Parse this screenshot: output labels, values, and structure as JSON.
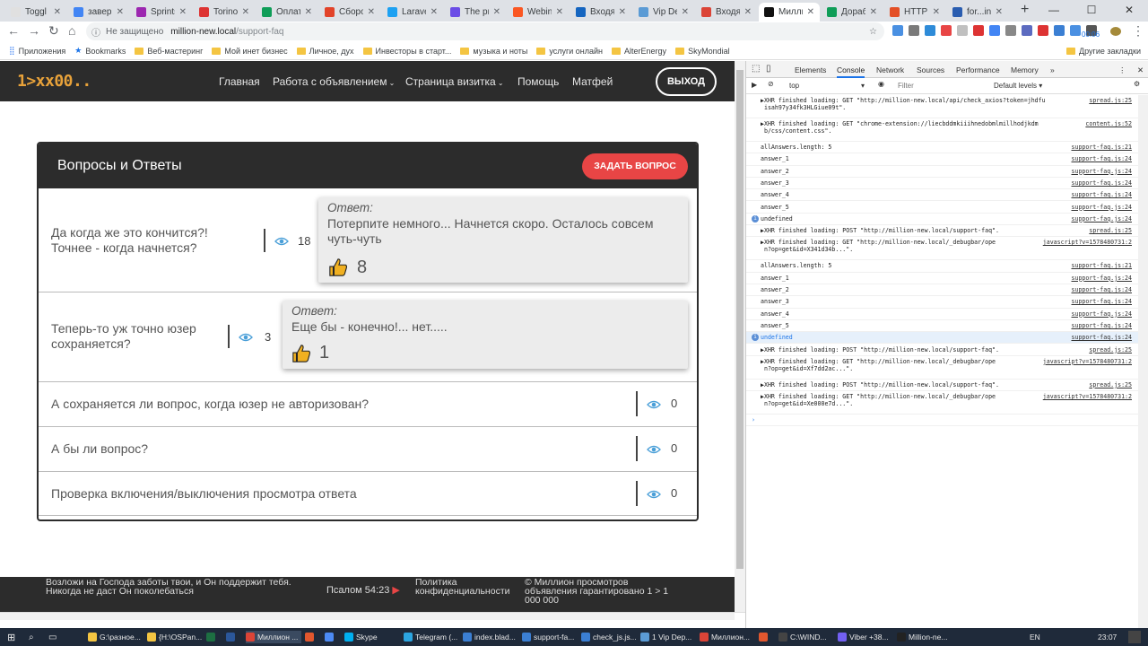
{
  "browser": {
    "tabs": [
      {
        "label": "Toggl",
        "color": "#e0e0e0"
      },
      {
        "label": "заверш",
        "color": "#4285f4"
      },
      {
        "label": "Sprints",
        "color": "#9c27b0"
      },
      {
        "label": "Torino",
        "color": "#d33"
      },
      {
        "label": "Оплата",
        "color": "#0f9d58"
      },
      {
        "label": "Сборо",
        "color": "#e24329"
      },
      {
        "label": "Laravel",
        "color": "#1da1f2"
      },
      {
        "label": "The pro",
        "color": "#6b4de6"
      },
      {
        "label": "Webiny",
        "color": "#fa5723"
      },
      {
        "label": "Входящ",
        "color": "#1565c0"
      },
      {
        "label": "Vip Dep",
        "color": "#5b9bd5"
      },
      {
        "label": "Входящ",
        "color": "#db4437"
      },
      {
        "label": "Миллио",
        "color": "#111"
      },
      {
        "label": "Доработ",
        "color": "#0f9d58"
      },
      {
        "label": "HTTP S",
        "color": "#e34f26"
      },
      {
        "label": "for...in",
        "color": "#2a5db0"
      }
    ],
    "active_tab": 12,
    "newtab_label": "+",
    "window_controls": [
      "—",
      "☐",
      "✕"
    ],
    "security_label": "Не защищено",
    "url_host": "million-new.local",
    "url_path": "/support-faq",
    "bookmarks": [
      "Приложения",
      "Bookmarks",
      "Веб-мастеринг",
      "Мой инет бизнес",
      "Личное, дух",
      "Инвесторы в старт...",
      "музыка и ноты",
      "услуги онлайн",
      "AlterEnergy",
      "SkyMondial"
    ],
    "other_bookmarks": "Другие закладки",
    "ext_badge": "00:06"
  },
  "site": {
    "logo": "1>xx00..",
    "nav": [
      {
        "label": "Главная"
      },
      {
        "label": "Работа с объявлением"
      },
      {
        "label": "Страница визитка"
      },
      {
        "label": "Помощь"
      },
      {
        "label": "Матфей"
      }
    ],
    "logout": "ВЫХОД",
    "faq_title": "Вопросы и Ответы",
    "ask_button": "ЗАДАТЬ ВОПРОС",
    "answer_label": "Ответ:",
    "questions": [
      {
        "text": "Да когда же это кончится?! Точнее - когда начнется?",
        "views": "18",
        "answer": "Потерпите немного... Начнется скоро. Осталось совсем чуть-чуть",
        "likes": "8"
      },
      {
        "text": "Теперь-то уж точно юзер сохраняется?",
        "views": "3",
        "answer": "Еще бы - конечно!... нет.....",
        "likes": "1"
      },
      {
        "text": "А сохраняется ли вопрос, когда юзер не авторизован?",
        "views": "0"
      },
      {
        "text": "А бы ли вопрос?",
        "views": "0"
      },
      {
        "text": "Проверка включения/выключения просмотра ответа",
        "views": "0"
      }
    ],
    "footer": {
      "quote": "Возложи на Господа заботы твои, и Он поддержит тебя. Никогда не даст Он поколебаться",
      "quote_ref": "Псалом 54:23",
      "privacy": "Политика конфиденциальности",
      "copyright": "© Миллион просмотров объявления гарантировано 1 > 1 000 000"
    }
  },
  "devtools": {
    "tabs": [
      "Elements",
      "Console",
      "Network",
      "Sources",
      "Performance",
      "Memory",
      "»"
    ],
    "active_tab": "Console",
    "context": "top",
    "filter_placeholder": "Filter",
    "levels": "Default levels ▾",
    "logs": [
      {
        "msg": "▶XHR finished loading: GET \"http://million-new.local/api/check_axios?token=jhdfu\n isah97y34fk3HLGiue09t\".",
        "src": "spread.js:25",
        "h": 2
      },
      {
        "msg": "▶XHR finished loading: GET \"chrome-extension://liecbddmkiiihnedobmlmillhodjkdm\n b/css/content.css\".",
        "src": "content.js:52",
        "h": 2
      },
      {
        "msg": "allAnswers.length: 5",
        "src": "support-faq.js:21",
        "h": 1
      },
      {
        "msg": "answer_1",
        "src": "support-faq.js:24",
        "h": 1
      },
      {
        "msg": "answer_2",
        "src": "support-faq.js:24",
        "h": 1
      },
      {
        "msg": "answer_3",
        "src": "support-faq.js:24",
        "h": 1
      },
      {
        "msg": "answer_4",
        "src": "support-faq.js:24",
        "h": 1
      },
      {
        "msg": "answer_5",
        "src": "support-faq.js:24",
        "h": 1
      },
      {
        "msg": "undefined",
        "src": "support-faq.js:24",
        "h": 1,
        "info": true
      },
      {
        "msg": "▶XHR finished loading: POST \"http://million-new.local/support-faq\".",
        "src": "spread.js:25",
        "h": 1
      },
      {
        "msg": "▶XHR finished loading: GET \"http://million-new.local/_debugbar/ope\n n?op=get&id=X341d34b...\".",
        "src": "javascript?v=1578480731:2",
        "h": 2
      },
      {
        "msg": "allAnswers.length: 5",
        "src": "support-faq.js:21",
        "h": 1
      },
      {
        "msg": "answer_1",
        "src": "support-faq.js:24",
        "h": 1
      },
      {
        "msg": "answer_2",
        "src": "support-faq.js:24",
        "h": 1
      },
      {
        "msg": "answer_3",
        "src": "support-faq.js:24",
        "h": 1
      },
      {
        "msg": "answer_4",
        "src": "support-faq.js:24",
        "h": 1
      },
      {
        "msg": "answer_5",
        "src": "support-faq.js:24",
        "h": 1
      },
      {
        "msg": "undefined",
        "src": "support-faq.js:24",
        "h": 1,
        "info": true,
        "sel": true
      },
      {
        "msg": "▶XHR finished loading: POST \"http://million-new.local/support-faq\".",
        "src": "spread.js:25",
        "h": 1
      },
      {
        "msg": "▶XHR finished loading: GET \"http://million-new.local/_debugbar/ope\n n?op=get&id=Xf7dd2ac...\".",
        "src": "javascript?v=1578480731:2",
        "h": 2
      },
      {
        "msg": "▶XHR finished loading: POST \"http://million-new.local/support-faq\".",
        "src": "spread.js:25",
        "h": 1
      },
      {
        "msg": "▶XHR finished loading: GET \"http://million-new.local/_debugbar/ope\n n?op=get&id=Xe000e7d...\".",
        "src": "javascript?v=1578480731:2",
        "h": 2
      },
      {
        "msg": "›",
        "src": "",
        "h": 1
      }
    ]
  },
  "taskbar": {
    "items": [
      {
        "label": "G:\\разное...",
        "color": "#f4c542"
      },
      {
        "label": "{H:\\OSPan...",
        "color": "#f4c542"
      },
      {
        "label": "",
        "color": "#1d6f42"
      },
      {
        "label": "",
        "color": "#2b579a"
      },
      {
        "label": "Миллион ...",
        "color": "#db4437",
        "active": true
      },
      {
        "label": "",
        "color": "#e2572e"
      },
      {
        "label": "",
        "color": "#4c8bf5"
      },
      {
        "label": "Skype",
        "color": "#00aff0"
      },
      {
        "label": "Telegram (...",
        "color": "#2ca5e0"
      },
      {
        "label": "index.blad...",
        "color": "#3b7fd3"
      },
      {
        "label": "support-fa...",
        "color": "#3b7fd3"
      },
      {
        "label": "check_js.js...",
        "color": "#3b7fd3"
      },
      {
        "label": "1 Vip Dep...",
        "color": "#5b9bd5"
      },
      {
        "label": "Миллион...",
        "color": "#db4437"
      },
      {
        "label": "",
        "color": "#e2572e"
      },
      {
        "label": "C:\\WIND...",
        "color": "#444"
      },
      {
        "label": "Viber +38...",
        "color": "#7360f2"
      },
      {
        "label": "Million-ne...",
        "color": "#222"
      }
    ],
    "lang": "EN",
    "time": "23:07"
  }
}
